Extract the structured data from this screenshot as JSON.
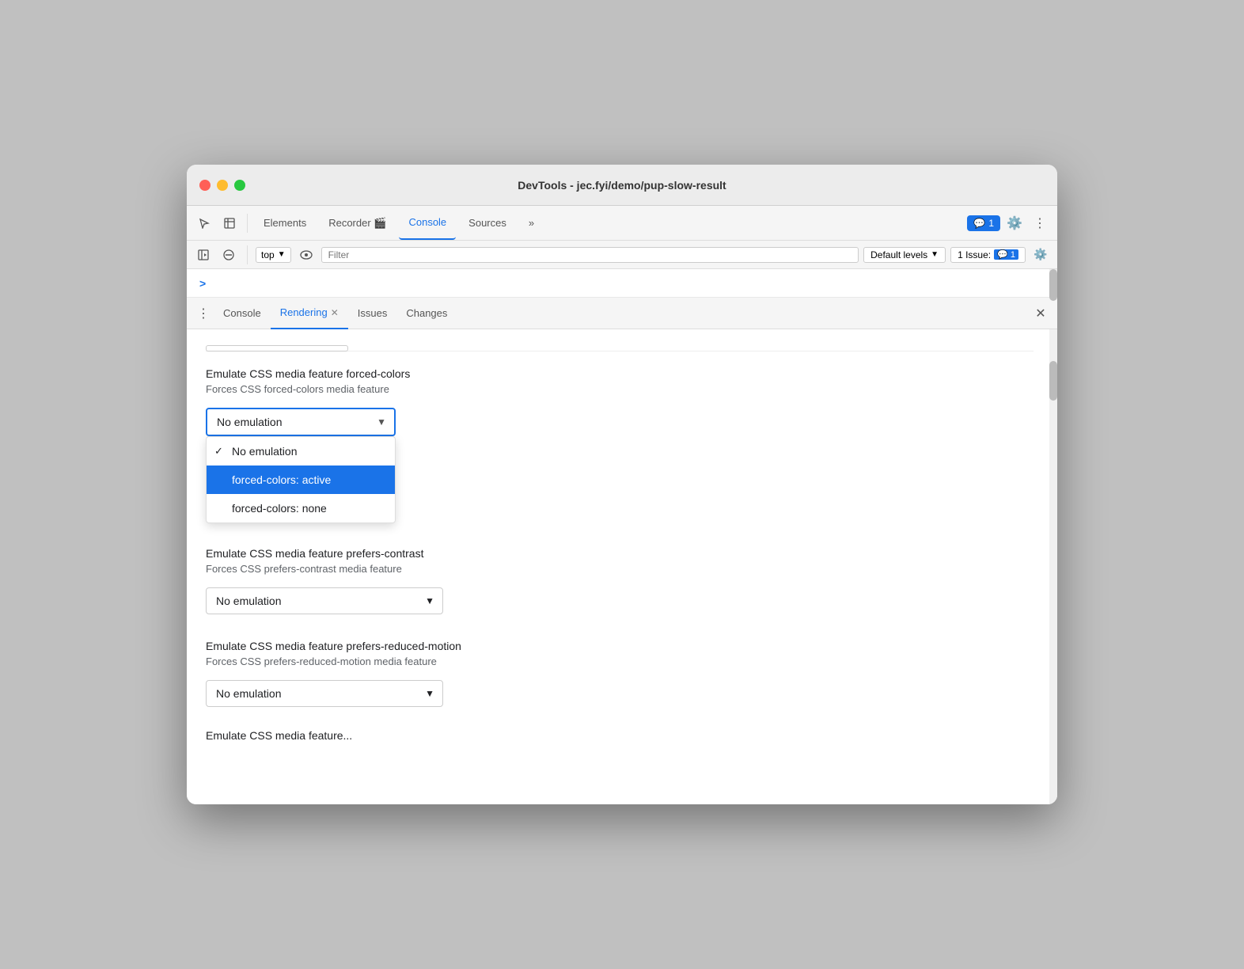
{
  "window": {
    "title": "DevTools - jec.fyi/demo/pup-slow-result"
  },
  "toolbar": {
    "tabs": [
      {
        "label": "Elements",
        "active": false
      },
      {
        "label": "Recorder 🎬",
        "active": false
      },
      {
        "label": "Console",
        "active": true
      },
      {
        "label": "Sources",
        "active": false
      }
    ],
    "more_label": "»",
    "badge_label": "1",
    "badge_icon": "💬"
  },
  "console_toolbar": {
    "top_label": "top",
    "filter_placeholder": "Filter",
    "levels_label": "Default levels",
    "issues_label": "1 Issue:",
    "issues_count": "1"
  },
  "panel_tabs": [
    {
      "label": "Console",
      "active": false,
      "closable": false
    },
    {
      "label": "Rendering",
      "active": true,
      "closable": true
    },
    {
      "label": "Issues",
      "active": false,
      "closable": false
    },
    {
      "label": "Changes",
      "active": false,
      "closable": false
    }
  ],
  "rendering": {
    "forced_colors": {
      "title": "Emulate CSS media feature forced-colors",
      "description": "Forces CSS forced-colors media feature",
      "dropdown_value": "No emulation",
      "options": [
        {
          "label": "No emulation",
          "checked": true,
          "selected": false
        },
        {
          "label": "forced-colors: active",
          "checked": false,
          "selected": true
        },
        {
          "label": "forced-colors: none",
          "checked": false,
          "selected": false
        }
      ]
    },
    "prefers_contrast": {
      "title": "Emulate CSS media feature prefers-contrast",
      "description": "Forces CSS prefers-contrast media feature",
      "dropdown_value": "No emulation"
    },
    "prefers_reduced_motion": {
      "title": "Emulate CSS media feature prefers-reduced-motion",
      "description": "Forces CSS prefers-reduced-motion media feature",
      "dropdown_value": "No emulation"
    },
    "bottom_truncated": "Emulate CSS media feature..."
  },
  "colors": {
    "accent": "#1a73e8",
    "selected_bg": "#1a73e8",
    "selected_text": "#ffffff",
    "border": "#ddd",
    "text_primary": "#202124",
    "text_secondary": "#5f6368"
  }
}
